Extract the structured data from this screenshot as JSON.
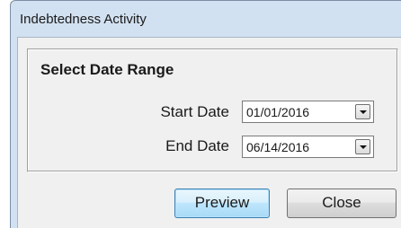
{
  "window": {
    "title": "Indebtedness Activity"
  },
  "group": {
    "title": "Select Date Range"
  },
  "start_date": {
    "label": "Start Date",
    "value": "01/01/2016"
  },
  "end_date": {
    "label": "End Date",
    "value": "06/14/2016"
  },
  "buttons": {
    "preview": "Preview",
    "close": "Close"
  },
  "icons": {
    "dropdown": "chevron-down-icon"
  },
  "colors": {
    "frame": "#d2e1f1",
    "client": "#f0f0f0",
    "default_button_border": "#3c7fb1"
  }
}
